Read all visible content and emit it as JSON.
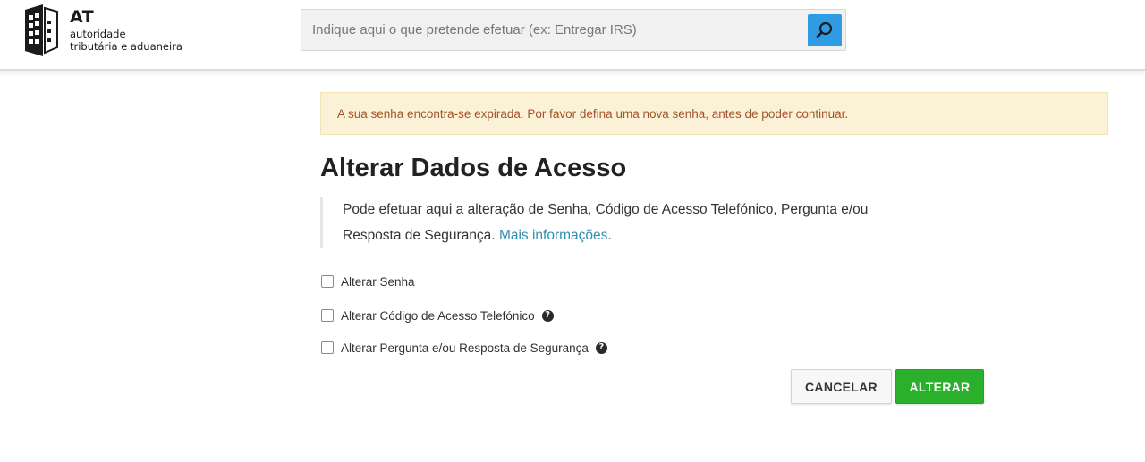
{
  "header": {
    "logo": {
      "title": "AT",
      "subtitle_line1": "autoridade",
      "subtitle_line2": "tributária e aduaneira"
    },
    "search": {
      "placeholder": "Indique aqui o que pretende efetuar (ex: Entregar IRS)",
      "button_icon": "search-icon",
      "button_color": "#2f9be3"
    }
  },
  "alert": {
    "text": "A sua senha encontra-se expirada. Por favor defina uma nova senha, antes de poder continuar.",
    "background": "#fbf1d6",
    "text_color": "#a2542a"
  },
  "main": {
    "title": "Alterar Dados de Acesso",
    "intro_line1": "Pode efetuar aqui a alteração de Senha, Código de Acesso Telefónico, Pergunta e/ou",
    "intro_line2": "Resposta de Segurança.",
    "intro_link": "Mais informações",
    "intro_link_suffix": ".",
    "options": [
      {
        "label": "Alterar Senha",
        "checked": false,
        "help": false
      },
      {
        "label": "Alterar Código de Acesso Telefónico",
        "checked": false,
        "help": true,
        "help_icon": "question-circle-icon"
      },
      {
        "label": "Alterar Pergunta e/ou Resposta de Segurança",
        "checked": false,
        "help": true,
        "help_icon": "question-circle-icon"
      }
    ],
    "buttons": {
      "cancel_label": "CANCELAR",
      "submit_label": "ALTERAR",
      "submit_color": "#2bb02b"
    }
  }
}
